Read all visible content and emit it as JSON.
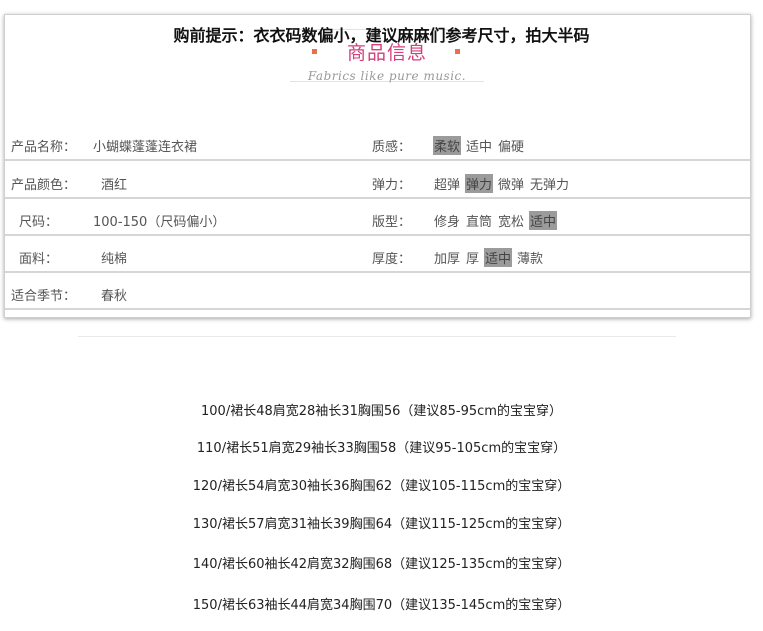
{
  "header": {
    "title": "商品信息",
    "subtitle": "Fabrics like pure music."
  },
  "colors": {
    "title": "#d23f7d",
    "dots": "#e8704f",
    "selected_bg": "#9b9b9b"
  },
  "rows": [
    {
      "label": "产品名称：",
      "value": "小蝴蝶蓬蓬连衣裙",
      "label2": "质感：",
      "options": [
        {
          "text": "柔软",
          "selected": true
        },
        {
          "text": "适中",
          "selected": false
        },
        {
          "text": "偏硬",
          "selected": false
        }
      ]
    },
    {
      "label": "产品颜色：",
      "value": "酒红",
      "label2": "弹力：",
      "options": [
        {
          "text": "超弹",
          "selected": false
        },
        {
          "text": "弹力",
          "selected": true
        },
        {
          "text": "微弹",
          "selected": false
        },
        {
          "text": "无弹力",
          "selected": false
        }
      ]
    },
    {
      "label": "尺码：",
      "value": "100-150（尺码偏小）",
      "label2": "版型：",
      "options": [
        {
          "text": "修身",
          "selected": false
        },
        {
          "text": "直筒",
          "selected": false
        },
        {
          "text": "宽松",
          "selected": false
        },
        {
          "text": "适中",
          "selected": true
        }
      ]
    },
    {
      "label": "面料：",
      "value": "纯棉",
      "label2": "厚度：",
      "options": [
        {
          "text": "加厚",
          "selected": false
        },
        {
          "text": "厚",
          "selected": false
        },
        {
          "text": "适中",
          "selected": true
        },
        {
          "text": "薄款",
          "selected": false
        }
      ]
    },
    {
      "label": "适合季节：",
      "value": "春秋",
      "label2": "",
      "options": []
    }
  ],
  "tips": {
    "heading": "购前提示：衣衣码数偏小，建议麻麻们参考尺寸，拍大半码",
    "sizes": [
      "100/裙长48肩宽28袖长31胸围56（建议85-95cm的宝宝穿）",
      "110/裙长51肩宽29袖长33胸围58（建议95-105cm的宝宝穿）",
      "120/裙长54肩宽30袖长36胸围62（建议105-115cm的宝宝穿）",
      "130/裙长57肩宽31袖长39胸围64（建议115-125cm的宝宝穿）",
      "140/裙长60袖长42肩宽32胸围68（建议125-135cm的宝宝穿）",
      "150/裙长63袖长44肩宽34胸围70（建议135-145cm的宝宝穿）"
    ]
  }
}
